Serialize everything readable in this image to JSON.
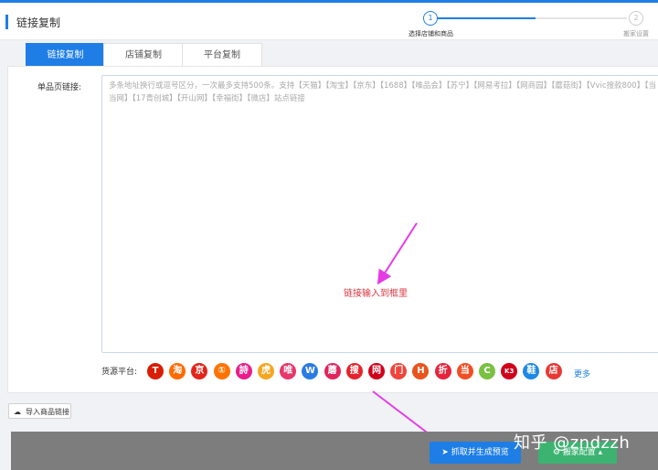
{
  "header": {
    "title": "链接复制"
  },
  "steps": [
    {
      "num": "1",
      "label": "选择店铺和商品"
    },
    {
      "num": "2",
      "label": "搬家设置"
    }
  ],
  "tabs": [
    {
      "label": "链接复制"
    },
    {
      "label": "店铺复制"
    },
    {
      "label": "平台复制"
    }
  ],
  "form": {
    "label": "单品页链接:",
    "placeholder": "多条地址换行或逗号区分，一次最多支持500条。支持【天猫】【淘宝】【京东】【1688】【唯品会】【苏宁】【网易考拉】【网商园】【蘑菇街】【Vvic搜款800】【当当网】【17青创城】【开山网】【幸福街】【微店】站点链接"
  },
  "annotation": "链接输入到框里",
  "platforms": {
    "label": "货源平台:",
    "more": "更多",
    "icons": [
      {
        "name": "tmall-icon",
        "glyph": "T",
        "color": "#d81e06"
      },
      {
        "name": "taobao-icon",
        "glyph": "淘",
        "color": "#ff6a00"
      },
      {
        "name": "jd-icon",
        "glyph": "京",
        "color": "#e1251b"
      },
      {
        "name": "ali1688-icon",
        "glyph": "①",
        "color": "#ff7300"
      },
      {
        "name": "shi-icon",
        "glyph": "詩",
        "color": "#e91e8c"
      },
      {
        "name": "tiger-icon",
        "glyph": "虎",
        "color": "#f5a623"
      },
      {
        "name": "vip-icon",
        "glyph": "唯",
        "color": "#e8366b"
      },
      {
        "name": "w-icon",
        "glyph": "W",
        "color": "#2a7be4"
      },
      {
        "name": "mogu-icon",
        "glyph": "蘑",
        "color": "#e0245e"
      },
      {
        "name": "sou-icon",
        "glyph": "搜",
        "color": "#e6232c"
      },
      {
        "name": "wangshang-icon",
        "glyph": "网",
        "color": "#d0021b"
      },
      {
        "name": "kaishan-icon",
        "glyph": "门",
        "color": "#f0453a"
      },
      {
        "name": "h-icon",
        "glyph": "H",
        "color": "#e8541e"
      },
      {
        "name": "zhe-icon",
        "glyph": "折",
        "color": "#e5243b"
      },
      {
        "name": "dangdang-icon",
        "glyph": "当",
        "color": "#f04e23"
      },
      {
        "name": "c-icon",
        "glyph": "C",
        "color": "#7ac143"
      },
      {
        "name": "k3-icon",
        "glyph": "K3",
        "color": "#d0021b"
      },
      {
        "name": "xie-icon",
        "glyph": "鞋",
        "color": "#1e88e5"
      },
      {
        "name": "dian-icon",
        "glyph": "店",
        "color": "#e53935"
      }
    ]
  },
  "import_button": "导入商品链接",
  "footer": {
    "primary": "抓取并生成预览",
    "secondary": "搬家配置"
  },
  "watermark": "知乎 @zndzzh"
}
